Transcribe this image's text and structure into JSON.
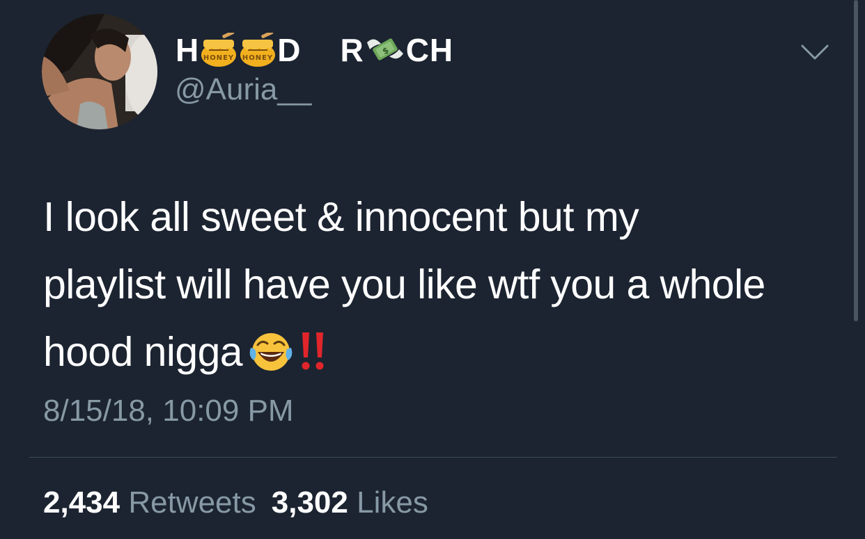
{
  "author": {
    "display_name_parts": [
      "H",
      "D",
      "R",
      "CH"
    ],
    "display_name_emoji": [
      "honey-pot",
      "honey-pot",
      "money-with-wings"
    ],
    "handle": "@Auria__"
  },
  "tweet": {
    "lines": [
      "I look all sweet & innocent but my",
      "playlist will have you like wtf you a whole",
      "hood nigga"
    ],
    "trailing_emoji": [
      "face-with-tears-of-joy",
      "double-exclamation-mark"
    ],
    "timestamp": "8/15/18, 10:09 PM"
  },
  "stats": {
    "retweets_count": "2,434",
    "retweets_label": "Retweets",
    "likes_count": "3,302",
    "likes_label": "Likes"
  },
  "colors": {
    "background": "#1c2431",
    "primary_text": "#ffffff",
    "secondary_text": "#8899a6",
    "divider": "#3d4a58"
  }
}
